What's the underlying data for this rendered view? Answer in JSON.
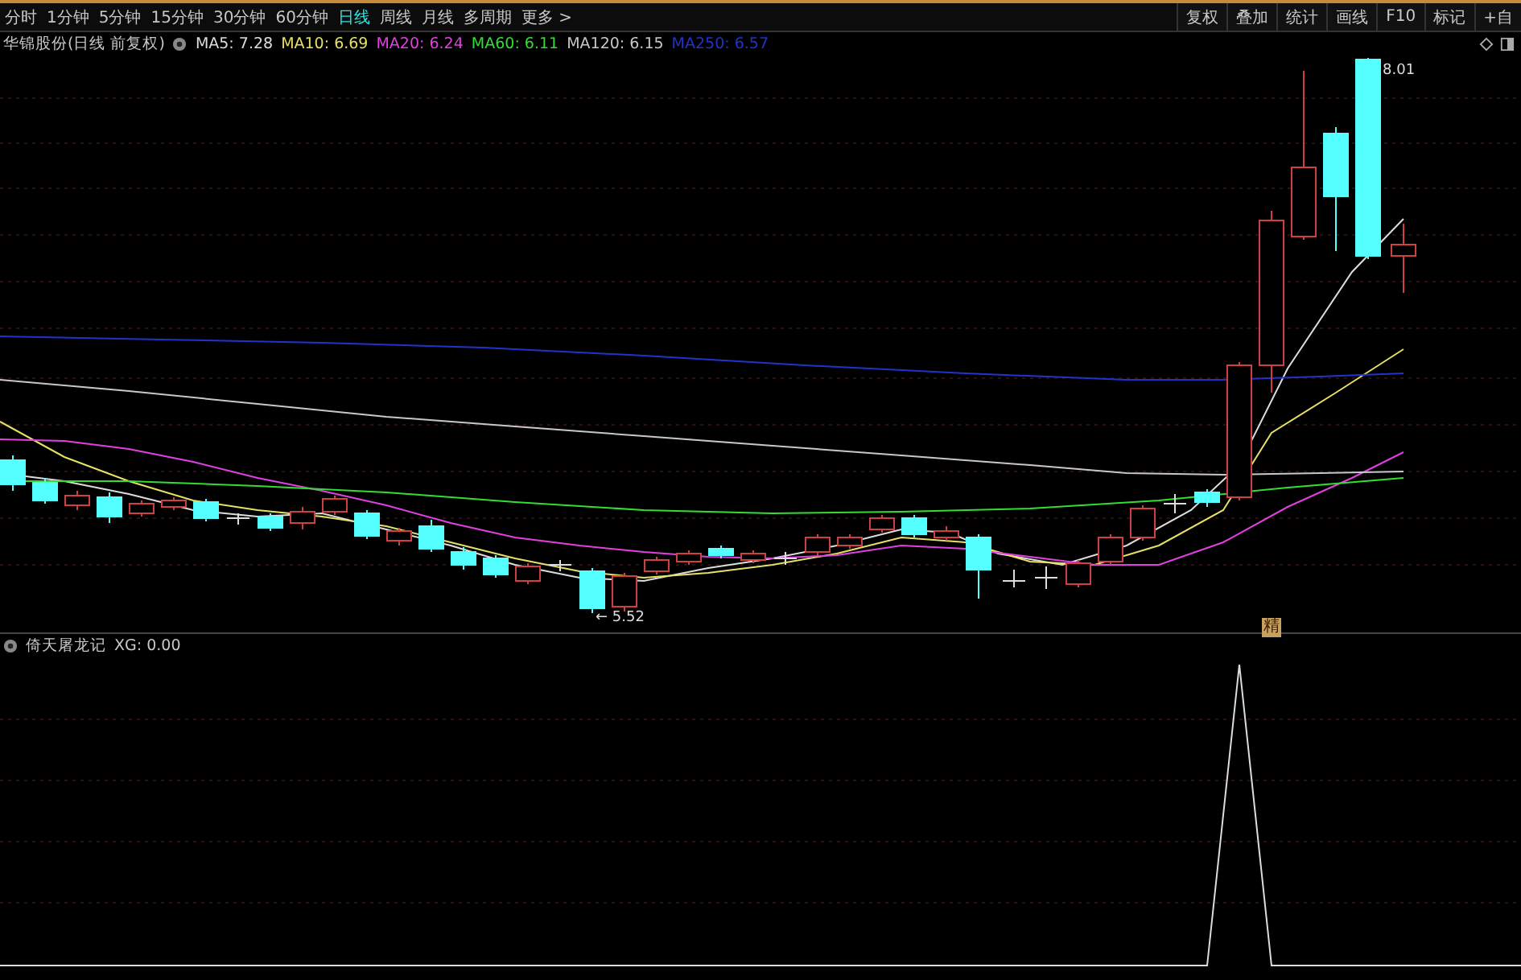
{
  "periods": [
    {
      "label": "分时",
      "selected": false
    },
    {
      "label": "1分钟",
      "selected": false
    },
    {
      "label": "5分钟",
      "selected": false
    },
    {
      "label": "15分钟",
      "selected": false
    },
    {
      "label": "30分钟",
      "selected": false
    },
    {
      "label": "60分钟",
      "selected": false
    },
    {
      "label": "日线",
      "selected": true
    },
    {
      "label": "周线",
      "selected": false
    },
    {
      "label": "月线",
      "selected": false
    },
    {
      "label": "多周期",
      "selected": false
    },
    {
      "label": "更多 >",
      "selected": false
    }
  ],
  "tools": [
    "复权",
    "叠加",
    "统计",
    "画线",
    "F10",
    "标记",
    "+自"
  ],
  "legend": {
    "title": "华锦股份(日线 前复权)",
    "averages": [
      {
        "label": "MA5: 7.28",
        "color": "#dcdcdc"
      },
      {
        "label": "MA10: 6.69",
        "color": "#e6e066"
      },
      {
        "label": "MA20: 6.24",
        "color": "#e040e0"
      },
      {
        "label": "MA60: 6.11",
        "color": "#33dd33"
      },
      {
        "label": "MA120: 6.15",
        "color": "#c8c8c8"
      },
      {
        "label": "MA250: 6.57",
        "color": "#2233cc"
      }
    ]
  },
  "price_chart": {
    "high_label": "8.01",
    "low_label": "← 5.52",
    "marker": "精"
  },
  "indicator": {
    "name": "倚天屠龙记",
    "reading": "XG: 0.00"
  }
}
